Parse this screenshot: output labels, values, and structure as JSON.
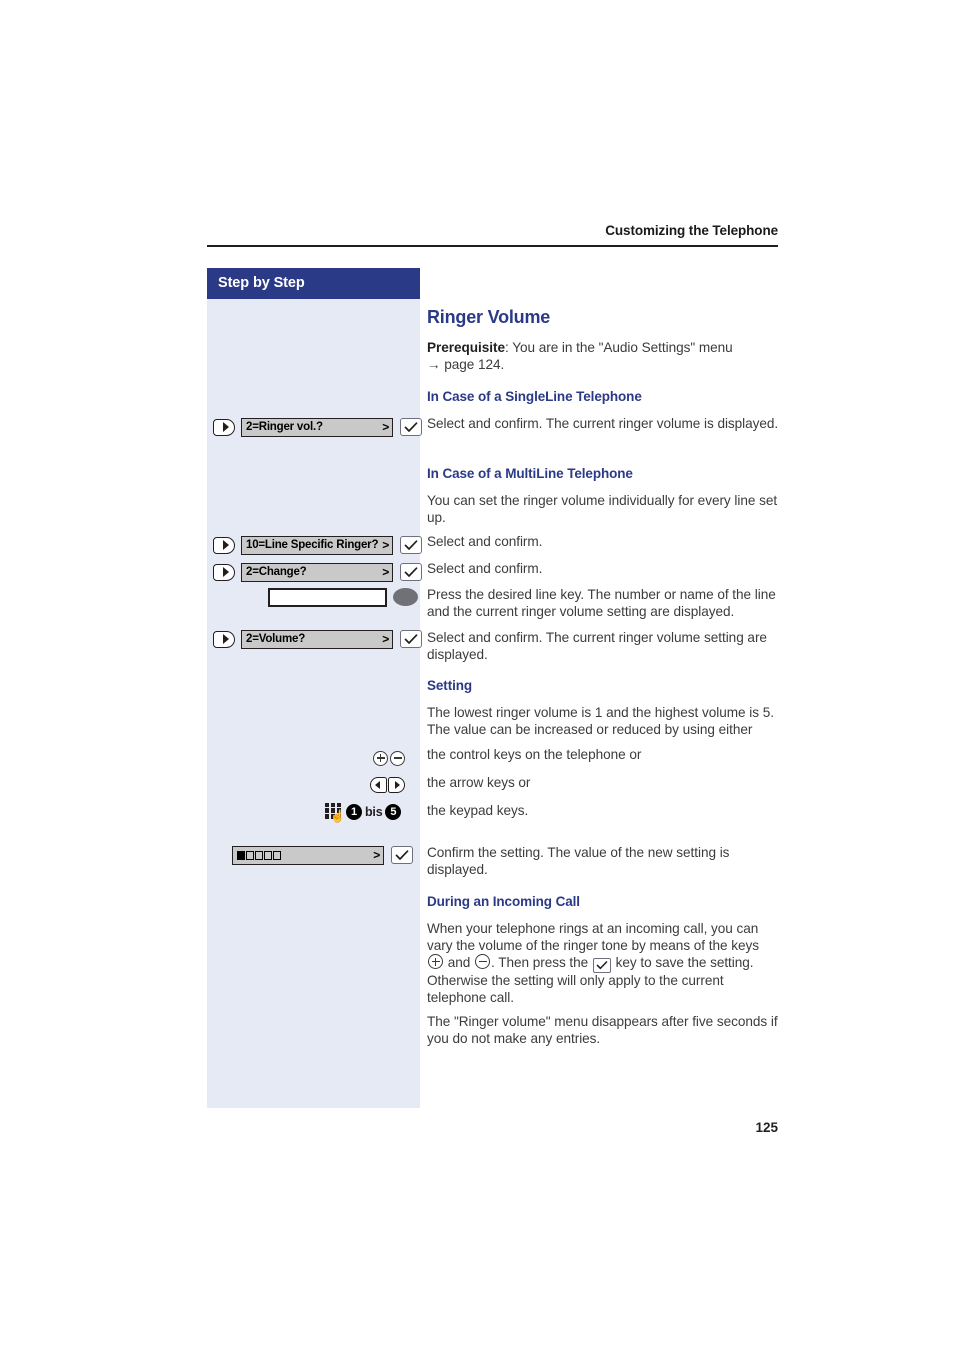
{
  "header": {
    "chapter_title": "Customizing the Telephone"
  },
  "sidebar": {
    "title": "Step by Step",
    "steps": [
      {
        "lcd_label": "2=Ringer vol.?",
        "lcd_arrow": ">"
      },
      {
        "lcd_label": "10=Line Specific Ringer?",
        "lcd_arrow": ">"
      },
      {
        "lcd_label": "2=Change?",
        "lcd_arrow": ">"
      },
      {
        "lcd_label": "2=Volume?",
        "lcd_arrow": ">"
      }
    ],
    "volume_bar": {
      "arrow": ">",
      "filled_segments": 1,
      "total_segments": 5
    },
    "key_legend": {
      "plus": "+",
      "minus": "−",
      "digit_from": "1",
      "bis": "bis",
      "digit_to": "5"
    }
  },
  "content": {
    "title": "Ringer Volume",
    "prerequisite_label": "Prerequisite",
    "prerequisite_text": ": You are in the \"Audio Settings\" menu",
    "prerequisite_arrow": "→",
    "prerequisite_page": "page 124.",
    "singleline_heading": "In Case of a SingleLine Telephone",
    "singleline_text": "Select and confirm. The current ringer volume is displayed.",
    "multiline_heading": "In Case of a MultiLine Telephone",
    "multiline_text": "You can set the ringer volume individually for every line set up.",
    "step_select_confirm_1": "Select and confirm.",
    "step_select_confirm_2": "Select and confirm.",
    "step_line_key": "Press the desired line key. The number or name of the line and the current ringer volume setting are displayed.",
    "step_volume": "Select and confirm. The current ringer volume setting are displayed.",
    "setting_heading": "Setting",
    "setting_text": "The lowest ringer volume is 1 and the highest volume is 5. The value can be increased or reduced by using either",
    "control_keys_text": "the control keys on the telephone or",
    "arrow_keys_text": "the arrow keys or",
    "keypad_keys_text": "the keypad keys.",
    "confirm_text": "Confirm the setting. The value of the new setting is displayed.",
    "incoming_heading": "During an Incoming Call",
    "incoming_text_part1": "When your telephone rings at an incoming call, you can vary the volume of the ringer tone by means of the keys",
    "incoming_text_and": "and",
    "incoming_text_part2": ". Then press the",
    "incoming_text_part3": "key to save the setting. Otherwise the setting will only apply to the current telephone call.",
    "timeout_text": "The \"Ringer volume\" menu disappears after five seconds if you do not make any entries."
  },
  "footer": {
    "page_number": "125"
  }
}
